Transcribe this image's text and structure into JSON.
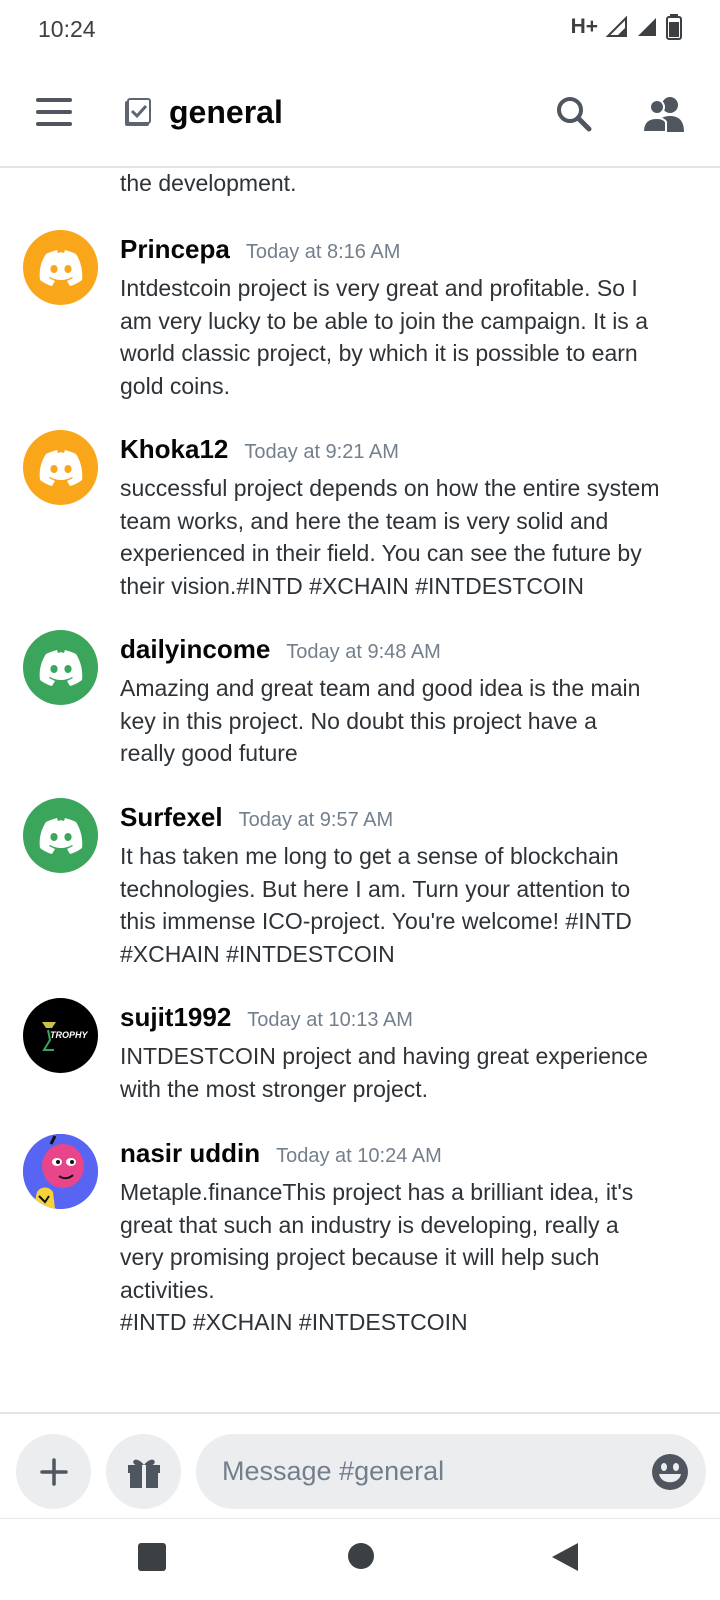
{
  "status_bar": {
    "time": "10:24",
    "network": "H+"
  },
  "header": {
    "channel_name": "general"
  },
  "partial_message": "the development.",
  "messages": [
    {
      "username": "Princepa",
      "timestamp": "Today at 8:16 AM",
      "avatar": "discord-logo-orange",
      "text": "Intdestcoin project is very great and profitable. So I\nam very lucky to be able to join the campaign. It is a\nworld classic project, by which it is possible to earn\ngold coins."
    },
    {
      "username": "Khoka12",
      "timestamp": "Today at 9:21 AM",
      "avatar": "discord-logo-orange",
      "text": "successful project depends on how the entire system\nteam works, and here the team is very solid and\nexperienced in their field. You can see the future by\ntheir vision.#INTD #XCHAIN   #INTDESTCOIN"
    },
    {
      "username": "dailyincome",
      "timestamp": "Today at 9:48 AM",
      "avatar": "discord-logo-green",
      "text": "Amazing and great team and good idea is the main\nkey in this project. No doubt this project have a\nreally good future"
    },
    {
      "username": "Surfexel",
      "timestamp": "Today at 9:57 AM",
      "avatar": "discord-logo-green",
      "text": "It has taken me long to get a sense of blockchain\ntechnologies. But here I am. Turn your attention to\nthis immense ICO-project. You're welcome! #INTD\n#XCHAIN   #INTDESTCOIN"
    },
    {
      "username": "sujit1992",
      "timestamp": "Today at 10:13 AM",
      "avatar": "trophy-logo",
      "avatar_text": "TROPHY",
      "text": "INTDESTCOIN project and having great experience\nwith the most stronger project."
    },
    {
      "username": "nasir uddin",
      "timestamp": "Today at 10:24 AM",
      "avatar": "cartoon-avatar",
      "text": "Metaple.financeThis project has a brilliant idea, it's\ngreat that such an industry is developing, really a\nvery promising project because it will help such\nactivities.\n#INTD #XCHAIN   #INTDESTCOIN"
    }
  ],
  "composer": {
    "placeholder": "Message #general"
  },
  "colors": {
    "orange_avatar": "#faa61a",
    "green_avatar": "#3ba55c",
    "trophy_bg": "#000000",
    "cartoon_bg": "#5865f2"
  }
}
